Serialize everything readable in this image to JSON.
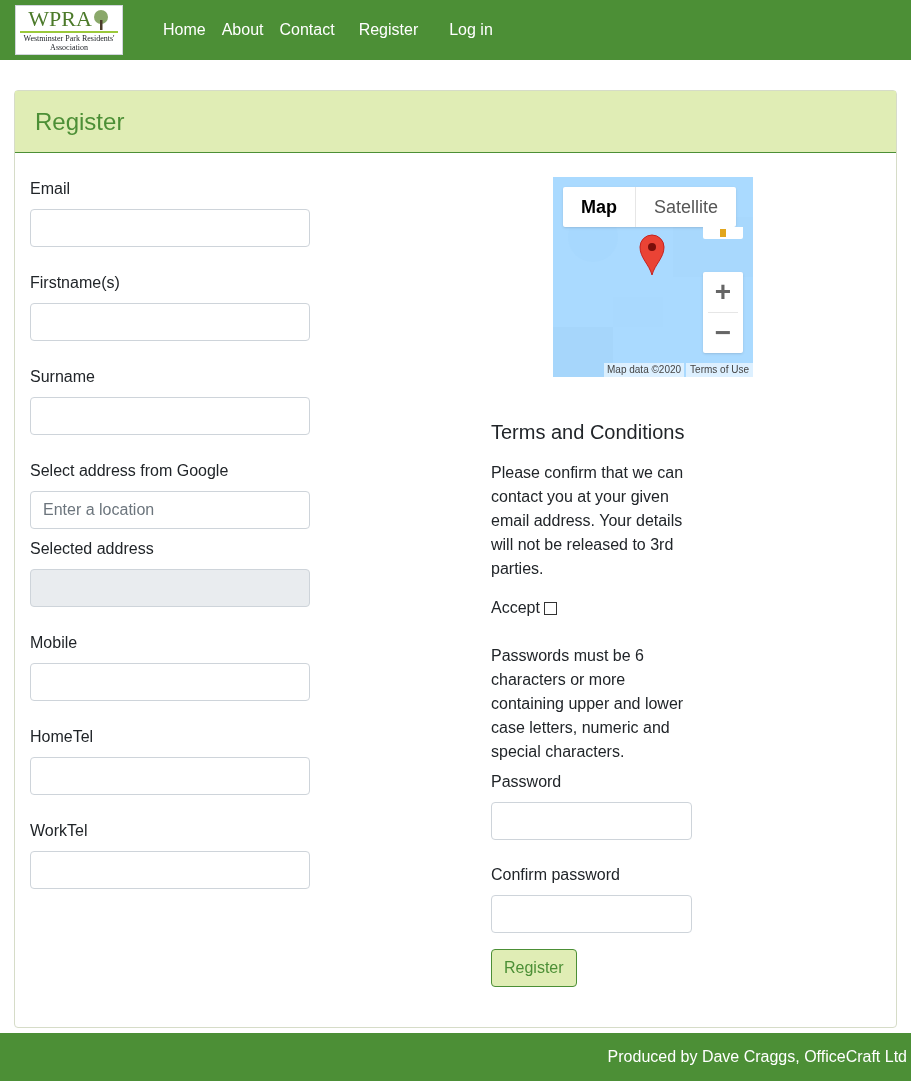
{
  "logo": {
    "title": "WPRA",
    "subtitle": "Westminster Park Residents' Association"
  },
  "nav": [
    {
      "label": "Home"
    },
    {
      "label": "About"
    },
    {
      "label": "Contact"
    },
    {
      "label": "Register"
    },
    {
      "label": "Log in"
    }
  ],
  "card": {
    "title": "Register"
  },
  "fields": [
    {
      "label": "Email",
      "kind": "input"
    },
    {
      "label": "Firstname(s)",
      "kind": "input"
    },
    {
      "label": "Surname",
      "kind": "input"
    },
    {
      "label": "Select address from Google",
      "kind": "input",
      "placeholder": "Enter a location"
    },
    {
      "label": "Selected address",
      "kind": "disabled"
    },
    {
      "label": "Mobile",
      "kind": "input"
    },
    {
      "label": "HomeTel",
      "kind": "input"
    },
    {
      "label": "WorkTel",
      "kind": "input"
    }
  ],
  "map": {
    "map_types": [
      {
        "label": "Map",
        "selected": true
      },
      {
        "label": "Satellite",
        "selected": false
      }
    ],
    "zoom_in": "+",
    "zoom_out": "−",
    "attribution": "Map data ©2020",
    "terms": "Terms of Use"
  },
  "terms": {
    "title": "Terms and Conditions",
    "text": "Please confirm that we can contact you at your given email address. Your details will not be released to 3rd parties.",
    "accept_label": "Accept",
    "accepted": false
  },
  "password_rules": "Passwords must be 6 characters or more containing upper and lower case letters, numeric and special characters.",
  "password_fields": [
    {
      "label": "Password"
    },
    {
      "label": "Confirm password"
    }
  ],
  "submit": "Register",
  "footer": "Produced by Dave Craggs, OfficeCraft Ltd"
}
